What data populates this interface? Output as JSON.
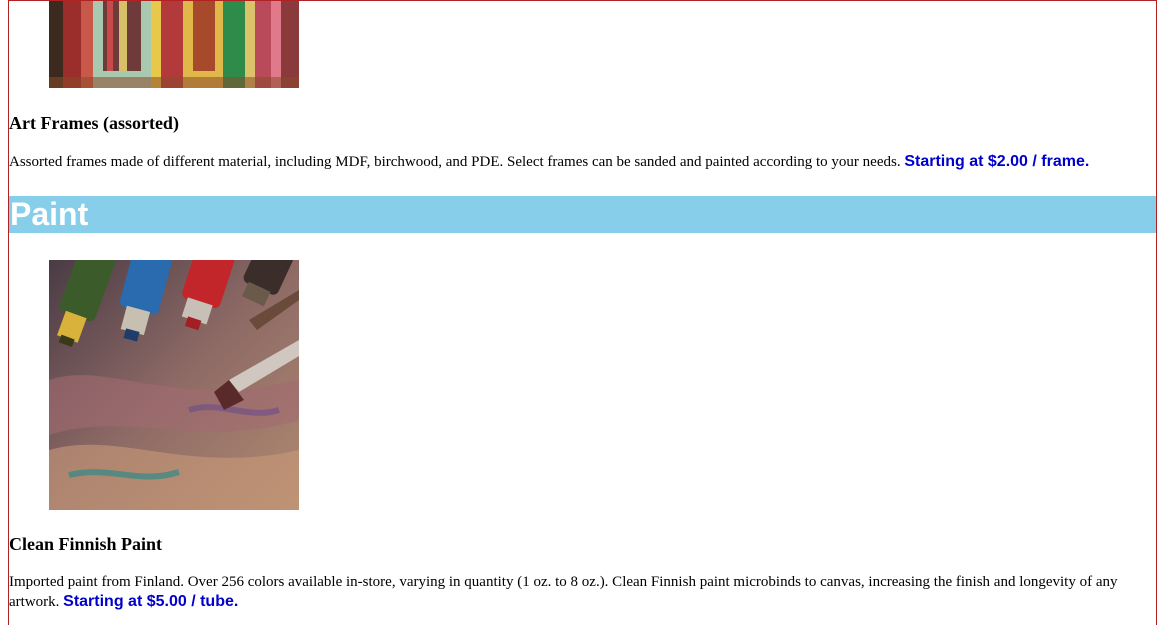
{
  "products": [
    {
      "name": "Art Frames (assorted)",
      "description": "Assorted frames made of different material, including MDF, birchwood, and PDE. Select frames can be sanded and painted according to your needs.",
      "price": "Starting at $2.00 / frame."
    },
    {
      "name": "Clean Finnish Paint",
      "description": "Imported paint from Finland. Over 256 colors available in-store, varying in quantity (1 oz. to 8 oz.). Clean Finnish paint microbinds to canvas, increasing the finish and longevity of any artwork.",
      "price": "Starting at $5.00 / tube."
    }
  ],
  "section": {
    "title": "Paint"
  },
  "colors": {
    "banner": "#87ceeb",
    "price": "#0000cd",
    "border": "#b22222"
  }
}
